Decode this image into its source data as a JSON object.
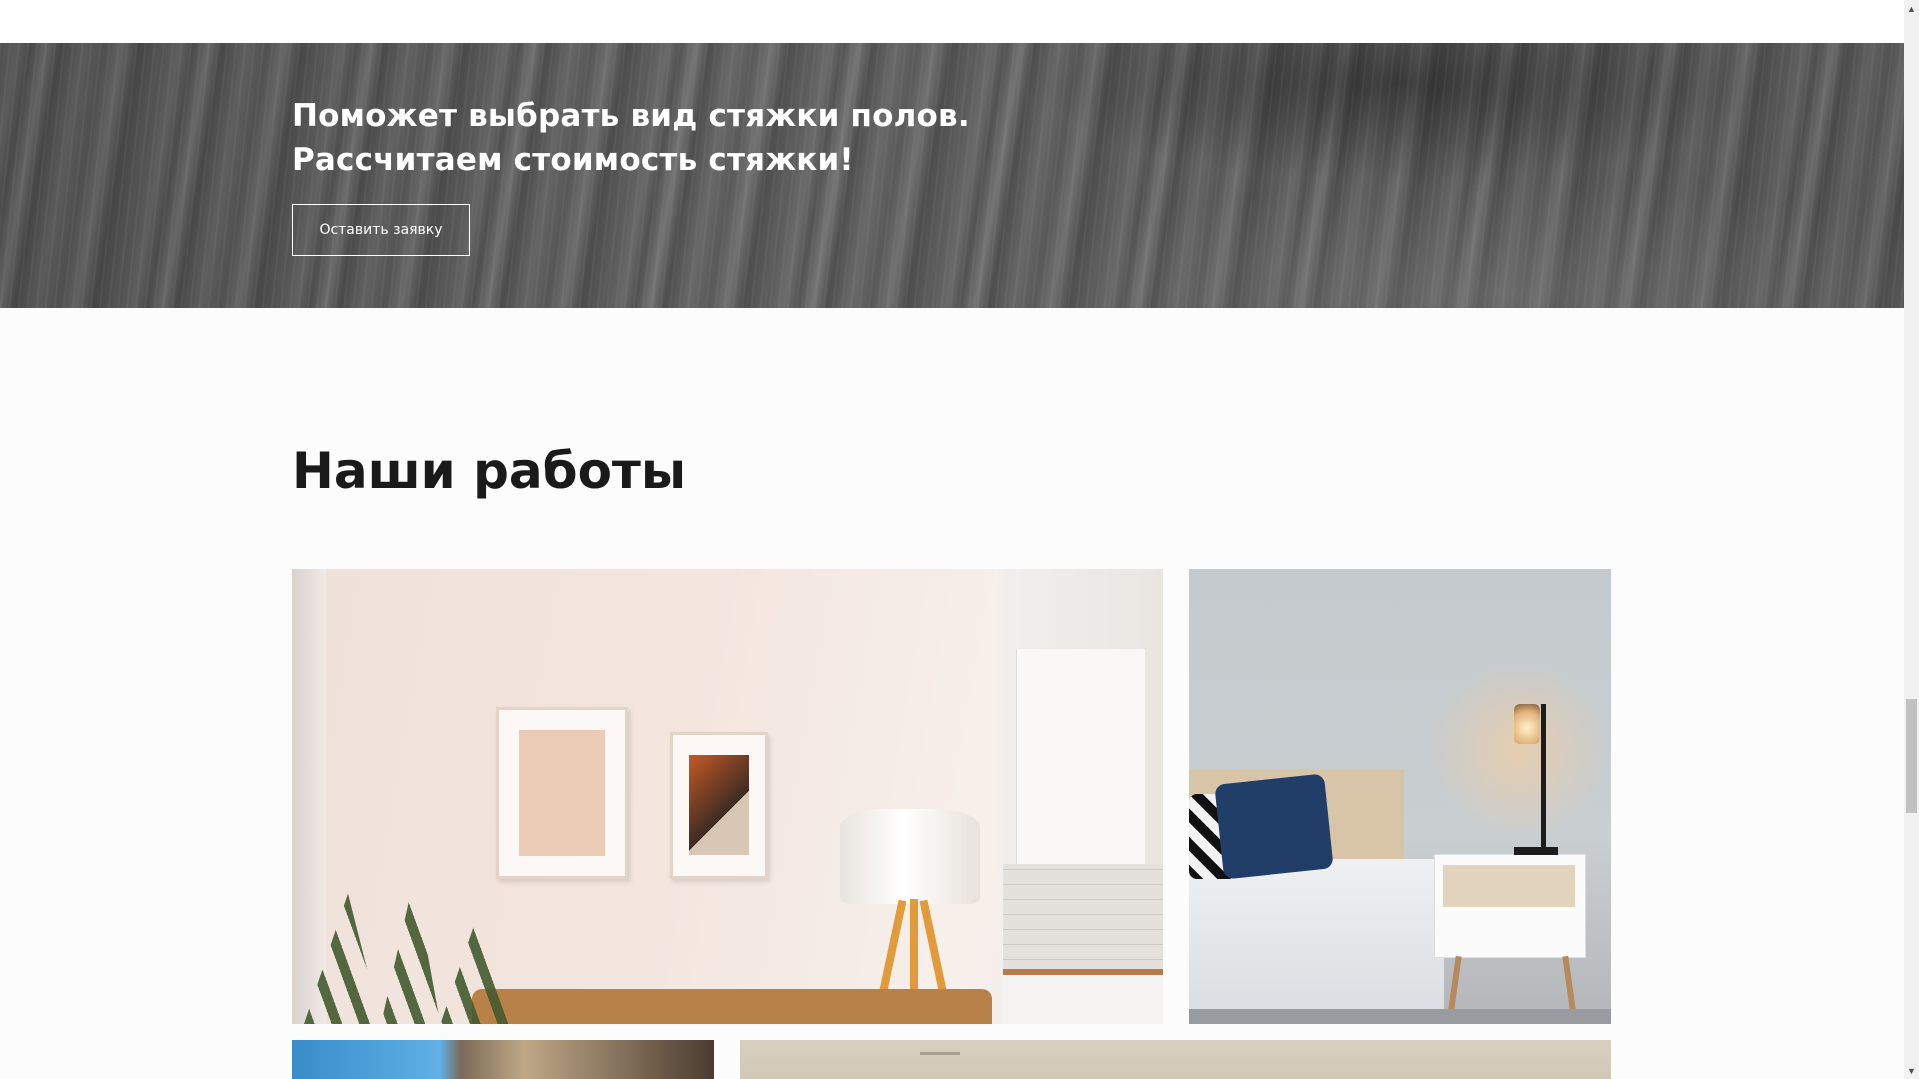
{
  "hero": {
    "title_line1": "Поможет выбрать вид стяжки полов.",
    "title_line2": "Рассчитаем стоимость стяжки!",
    "button_label": "Оставить заявку"
  },
  "works": {
    "title": "Наши работы"
  },
  "scrollbar": {
    "up_icon": "▲",
    "down_icon": "▼"
  }
}
